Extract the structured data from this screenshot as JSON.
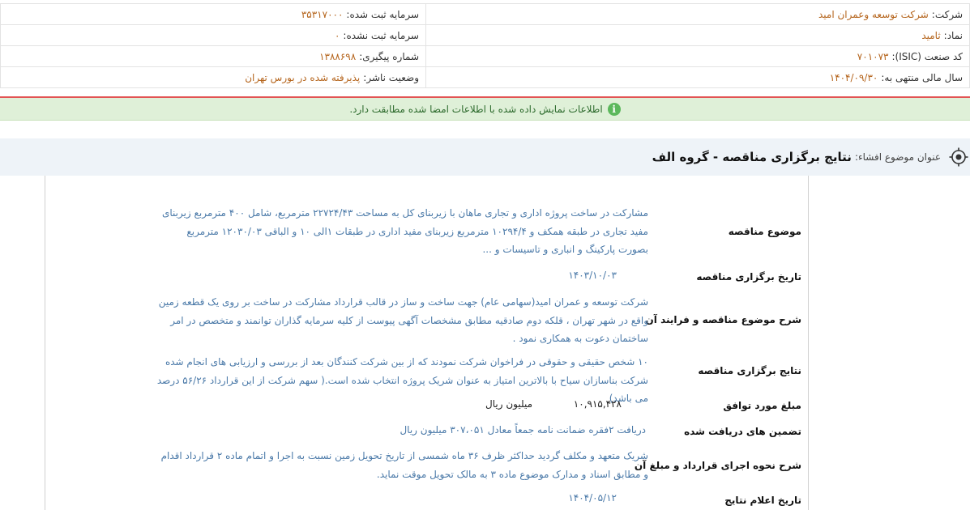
{
  "header": {
    "rows": [
      {
        "right": {
          "label": "شرکت:",
          "value": "شرکت توسعه وعمران امید"
        },
        "left": {
          "label": "سرمایه ثبت شده:",
          "value": "۳۵۳۱۷۰۰۰"
        }
      },
      {
        "right": {
          "label": "نماد:",
          "value": "ثامید"
        },
        "left": {
          "label": "سرمایه ثبت نشده:",
          "value": "۰"
        }
      },
      {
        "right": {
          "label": "کد صنعت (ISIC):",
          "value": "۷۰۱۰۷۳"
        },
        "left": {
          "label": "شماره پیگیری:",
          "value": "۱۳۸۸۶۹۸"
        }
      },
      {
        "right": {
          "label": "سال مالی منتهی به:",
          "value": "۱۴۰۴/۰۹/۳۰"
        },
        "left": {
          "label": "وضعیت ناشر:",
          "value": "پذیرفته شده در بورس تهران"
        }
      }
    ]
  },
  "alert": {
    "icon": "info-icon",
    "text": "اطلاعات نمایش داده شده با اطلاعات امضا شده مطابقت دارد."
  },
  "topic": {
    "icon": "target-icon",
    "label": "عنوان موضوع افشاء:",
    "title": "نتایج برگزاری مناقصه - گروه الف"
  },
  "details": {
    "subject_label": "موضوع مناقصه",
    "subject_value": "مشارکت در ساخت پروژه اداری و تجاری ماهان با زیربنای کل به مساحت ۲۲۷۲۴/۴۳ مترمربع، شامل ۴۰۰ مترمربع زیربنای مفید تجاری در طبقه همکف و ۱۰۲۹۴/۴ مترمربع زیربنای مفید اداری در طبقات ۱الی ۱۰ و الباقی ۱۲۰۳۰/۰۳ مترمربع بصورت پارکینگ و انباری و تاسیسات و ...",
    "date_label": "تاریخ برگزاری مناقصه",
    "date_value": "۱۴۰۳/۱۰/۰۳",
    "process_label": "شرح موضوع مناقصه و فرایند آن",
    "process_value": "شرکت توسعه و عمران امید(سهامی عام) جهت ساخت و ساز در قالب قرارداد مشارکت در ساخت بر روی یک قطعه زمین واقع در شهر تهران ، قلکه دوم صادقیه مطابق مشخصات آگهی پیوست از کلیه سرمایه گذاران توانمند و متخصص در امر ساختمان دعوت به همکاری نمود .",
    "results_label": "نتایج برگزاری مناقصه",
    "results_value": "۱۰ شخص حقیقی و حقوقی در فراخوان شرکت نمودند که از بین شرکت کنندگان بعد از بررسی و ارزیابی های انجام شده شرکت بناسازان سیاح با بالاترین امتیاز به عنوان شریک پروژه انتخاب شده است.( سهم شرکت از این قرارداد ۵۶/۲۶ درصد می باشد)",
    "amount_label": "مبلغ مورد توافق",
    "amount_value": "۱۰,۹۱۵,۴۲۸",
    "amount_unit": "میلیون ریال",
    "guarantee_label": "تضمین های دریافت شده",
    "guarantee_value": "دریافت ۲فقره ضمانت نامه جمعاً معادل ۳۰۷،۰۵۱ میلیون ریال",
    "execution_label": "شرح نحوه اجرای قرارداد و مبلغ آن",
    "execution_value": "شریک متعهد و مکلف گردید حداکثر ظرف ۳۶ ماه شمسی از تاریخ تحویل زمین نسبت به اجرا و اتمام ماده ۲ قرارداد اقدام و مطابق اسناد و مدارک موضوع ماده ۳ به مالک تحویل موقت نماید.",
    "announce_label": "تاریخ اعلام نتایج",
    "announce_value": "۱۴۰۴/۰۵/۱۲"
  },
  "colors": {
    "value_orange": "#b5651d",
    "value_blue": "#4a79a8",
    "alert_bg": "#dff0d8",
    "alert_border": "#e25454",
    "topic_bg": "#eef3f8"
  }
}
